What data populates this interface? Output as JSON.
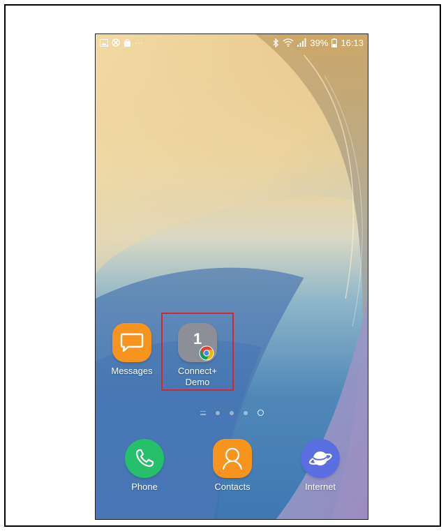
{
  "status_bar": {
    "left_icons": [
      "gallery-icon",
      "blocked-icon",
      "shopping-bag-icon",
      "more-dots-icon"
    ],
    "more_indicator": "···",
    "right_icons": [
      "bluetooth-icon",
      "wifi-icon",
      "signal-icon"
    ],
    "battery_percent": "39%",
    "time": "16:13"
  },
  "home_apps": [
    {
      "name": "messages",
      "label": "Messages",
      "icon": "chat-bubble-icon",
      "color": "#f7941d"
    },
    {
      "name": "folder",
      "label": "Connect+\nDemo",
      "icon": "folder-icon",
      "badge_count": "1",
      "badge_icon": "chrome-icon",
      "color": "#8d8f98"
    }
  ],
  "pager": {
    "pages": 5,
    "active_index": 4
  },
  "dock": [
    {
      "name": "phone",
      "label": "Phone",
      "icon": "phone-handset-icon",
      "color": "#26c06a"
    },
    {
      "name": "contacts",
      "label": "Contacts",
      "icon": "person-icon",
      "color": "#f7941d"
    },
    {
      "name": "internet",
      "label": "Internet",
      "icon": "planet-icon",
      "color": "#5b6ee1"
    }
  ],
  "highlight_color": "#d9232d"
}
